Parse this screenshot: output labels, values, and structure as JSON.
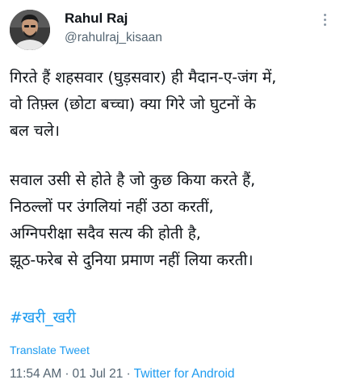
{
  "author": {
    "display_name": "Rahul Raj",
    "handle": "@rahulraj_kisaan"
  },
  "tweet": {
    "lines": [
      "गिरते हैं शहसवार (घुड़सवार) ही मैदान-ए-जंग में,",
      "वो तिफ़्ल (छोटा बच्चा) क्या गिरे जो घुटनों के",
      "बल चले।",
      "सवाल उसी से होते है जो कुछ किया करते हैं,",
      "निठल्लों पर उंगलियां नहीं उठा करतीं,",
      "अग्निपरीक्षा सदैव सत्य की होती है,",
      "झूठ-फरेब से दुनिया प्रमाण नहीं लिया करती।"
    ],
    "hashtag": "#खरी_खरी"
  },
  "translate_label": "Translate Tweet",
  "meta": {
    "time": "11:54 AM",
    "date": "01 Jul 21",
    "source": "Twitter for Android",
    "separator": "·"
  },
  "icons": {
    "more": "more-vertical-icon",
    "avatar": "user-avatar"
  },
  "colors": {
    "accent": "#1d9bf0",
    "secondary_text": "#536471",
    "primary_text": "#0f1419"
  }
}
